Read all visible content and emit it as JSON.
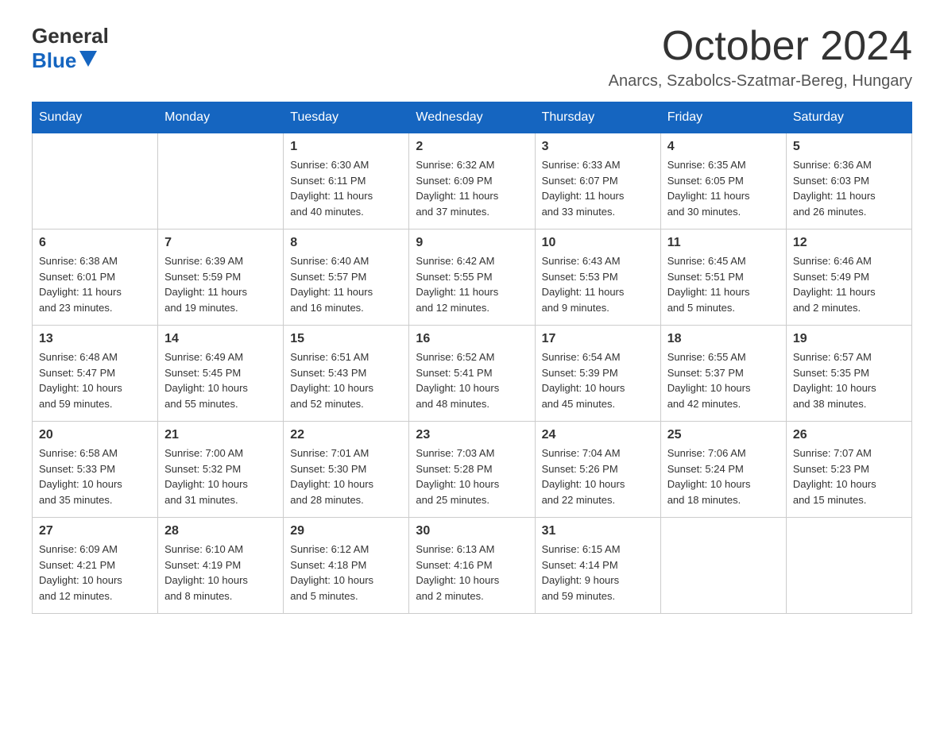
{
  "header": {
    "logo_general": "General",
    "logo_blue": "Blue",
    "month_title": "October 2024",
    "location": "Anarcs, Szabolcs-Szatmar-Bereg, Hungary"
  },
  "days_of_week": [
    "Sunday",
    "Monday",
    "Tuesday",
    "Wednesday",
    "Thursday",
    "Friday",
    "Saturday"
  ],
  "weeks": [
    [
      {
        "day": "",
        "info": ""
      },
      {
        "day": "",
        "info": ""
      },
      {
        "day": "1",
        "info": "Sunrise: 6:30 AM\nSunset: 6:11 PM\nDaylight: 11 hours\nand 40 minutes."
      },
      {
        "day": "2",
        "info": "Sunrise: 6:32 AM\nSunset: 6:09 PM\nDaylight: 11 hours\nand 37 minutes."
      },
      {
        "day": "3",
        "info": "Sunrise: 6:33 AM\nSunset: 6:07 PM\nDaylight: 11 hours\nand 33 minutes."
      },
      {
        "day": "4",
        "info": "Sunrise: 6:35 AM\nSunset: 6:05 PM\nDaylight: 11 hours\nand 30 minutes."
      },
      {
        "day": "5",
        "info": "Sunrise: 6:36 AM\nSunset: 6:03 PM\nDaylight: 11 hours\nand 26 minutes."
      }
    ],
    [
      {
        "day": "6",
        "info": "Sunrise: 6:38 AM\nSunset: 6:01 PM\nDaylight: 11 hours\nand 23 minutes."
      },
      {
        "day": "7",
        "info": "Sunrise: 6:39 AM\nSunset: 5:59 PM\nDaylight: 11 hours\nand 19 minutes."
      },
      {
        "day": "8",
        "info": "Sunrise: 6:40 AM\nSunset: 5:57 PM\nDaylight: 11 hours\nand 16 minutes."
      },
      {
        "day": "9",
        "info": "Sunrise: 6:42 AM\nSunset: 5:55 PM\nDaylight: 11 hours\nand 12 minutes."
      },
      {
        "day": "10",
        "info": "Sunrise: 6:43 AM\nSunset: 5:53 PM\nDaylight: 11 hours\nand 9 minutes."
      },
      {
        "day": "11",
        "info": "Sunrise: 6:45 AM\nSunset: 5:51 PM\nDaylight: 11 hours\nand 5 minutes."
      },
      {
        "day": "12",
        "info": "Sunrise: 6:46 AM\nSunset: 5:49 PM\nDaylight: 11 hours\nand 2 minutes."
      }
    ],
    [
      {
        "day": "13",
        "info": "Sunrise: 6:48 AM\nSunset: 5:47 PM\nDaylight: 10 hours\nand 59 minutes."
      },
      {
        "day": "14",
        "info": "Sunrise: 6:49 AM\nSunset: 5:45 PM\nDaylight: 10 hours\nand 55 minutes."
      },
      {
        "day": "15",
        "info": "Sunrise: 6:51 AM\nSunset: 5:43 PM\nDaylight: 10 hours\nand 52 minutes."
      },
      {
        "day": "16",
        "info": "Sunrise: 6:52 AM\nSunset: 5:41 PM\nDaylight: 10 hours\nand 48 minutes."
      },
      {
        "day": "17",
        "info": "Sunrise: 6:54 AM\nSunset: 5:39 PM\nDaylight: 10 hours\nand 45 minutes."
      },
      {
        "day": "18",
        "info": "Sunrise: 6:55 AM\nSunset: 5:37 PM\nDaylight: 10 hours\nand 42 minutes."
      },
      {
        "day": "19",
        "info": "Sunrise: 6:57 AM\nSunset: 5:35 PM\nDaylight: 10 hours\nand 38 minutes."
      }
    ],
    [
      {
        "day": "20",
        "info": "Sunrise: 6:58 AM\nSunset: 5:33 PM\nDaylight: 10 hours\nand 35 minutes."
      },
      {
        "day": "21",
        "info": "Sunrise: 7:00 AM\nSunset: 5:32 PM\nDaylight: 10 hours\nand 31 minutes."
      },
      {
        "day": "22",
        "info": "Sunrise: 7:01 AM\nSunset: 5:30 PM\nDaylight: 10 hours\nand 28 minutes."
      },
      {
        "day": "23",
        "info": "Sunrise: 7:03 AM\nSunset: 5:28 PM\nDaylight: 10 hours\nand 25 minutes."
      },
      {
        "day": "24",
        "info": "Sunrise: 7:04 AM\nSunset: 5:26 PM\nDaylight: 10 hours\nand 22 minutes."
      },
      {
        "day": "25",
        "info": "Sunrise: 7:06 AM\nSunset: 5:24 PM\nDaylight: 10 hours\nand 18 minutes."
      },
      {
        "day": "26",
        "info": "Sunrise: 7:07 AM\nSunset: 5:23 PM\nDaylight: 10 hours\nand 15 minutes."
      }
    ],
    [
      {
        "day": "27",
        "info": "Sunrise: 6:09 AM\nSunset: 4:21 PM\nDaylight: 10 hours\nand 12 minutes."
      },
      {
        "day": "28",
        "info": "Sunrise: 6:10 AM\nSunset: 4:19 PM\nDaylight: 10 hours\nand 8 minutes."
      },
      {
        "day": "29",
        "info": "Sunrise: 6:12 AM\nSunset: 4:18 PM\nDaylight: 10 hours\nand 5 minutes."
      },
      {
        "day": "30",
        "info": "Sunrise: 6:13 AM\nSunset: 4:16 PM\nDaylight: 10 hours\nand 2 minutes."
      },
      {
        "day": "31",
        "info": "Sunrise: 6:15 AM\nSunset: 4:14 PM\nDaylight: 9 hours\nand 59 minutes."
      },
      {
        "day": "",
        "info": ""
      },
      {
        "day": "",
        "info": ""
      }
    ]
  ]
}
